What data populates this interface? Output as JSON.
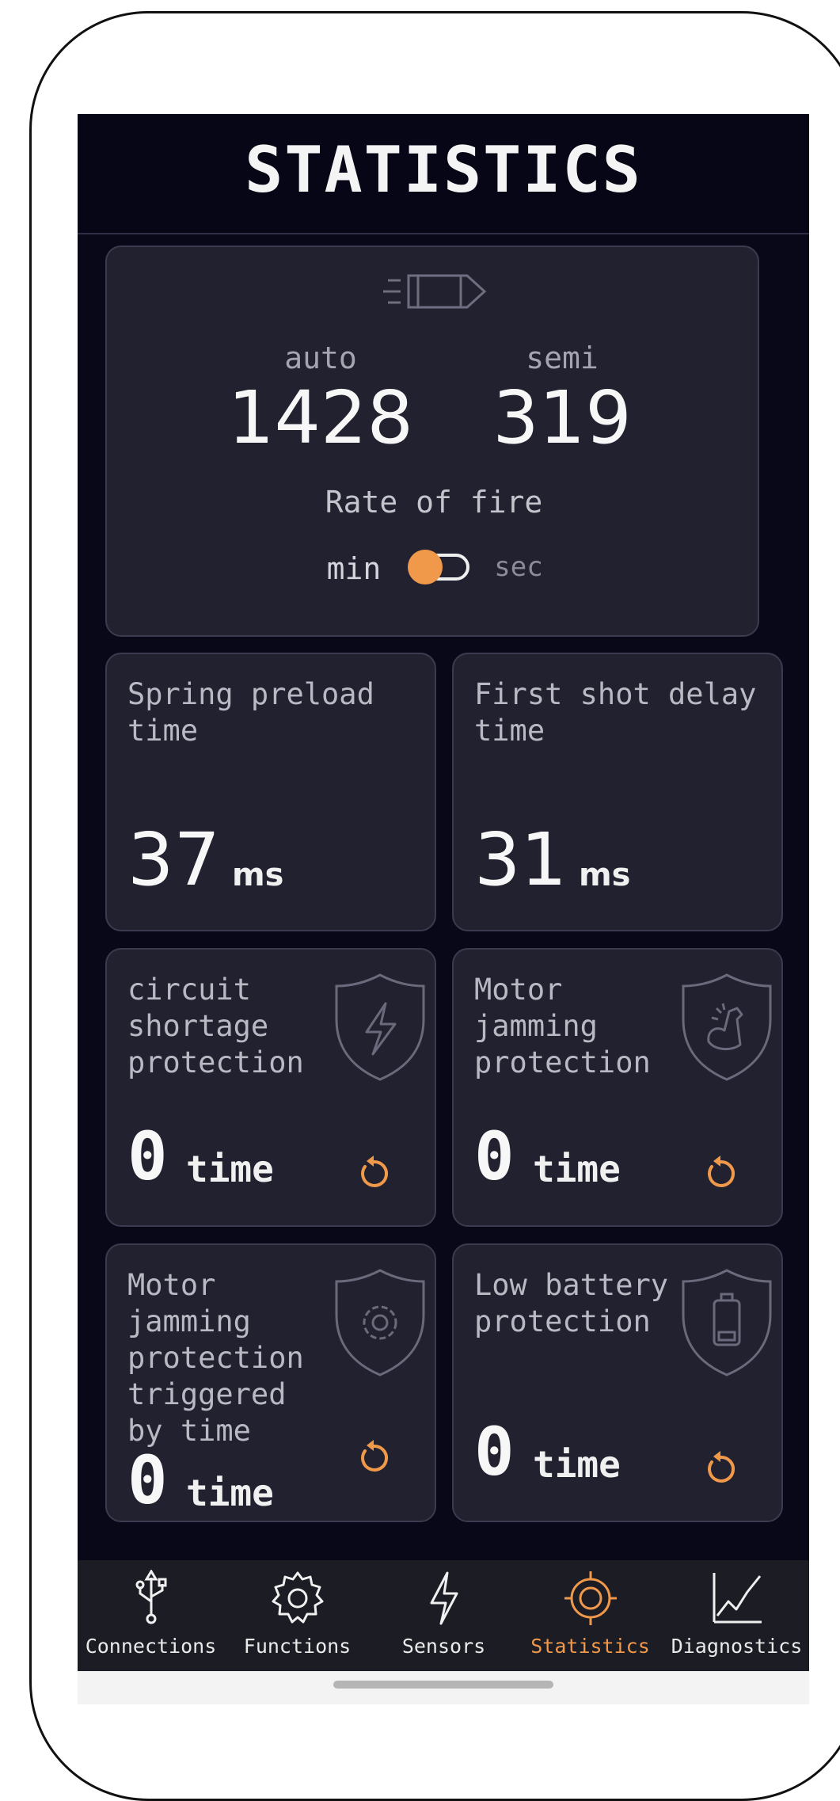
{
  "header": {
    "title": "STATISTICS"
  },
  "rate_card": {
    "icon": "bullet-icon",
    "auto_label": "auto",
    "auto_value": "1428",
    "semi_label": "semi",
    "semi_value": "319",
    "caption": "Rate of fire",
    "toggle": {
      "left_label": "min",
      "right_label": "sec",
      "selected": "min"
    }
  },
  "stats": [
    {
      "title_lines": [
        "Spring preload",
        "time"
      ],
      "value": "37",
      "unit": "ms"
    },
    {
      "title_lines": [
        "First shot delay",
        "time"
      ],
      "value": "31",
      "unit": "ms"
    },
    {
      "title_lines": [
        "circuit",
        "shortage",
        "protection"
      ],
      "value": "0",
      "unit": "time",
      "icon": "shield-lightning-icon"
    },
    {
      "title_lines": [
        "Motor",
        "jamming",
        "protection"
      ],
      "value": "0",
      "unit": "time",
      "icon": "shield-arm-icon"
    },
    {
      "title_lines": [
        "Motor",
        "jamming",
        "protection",
        "triggered",
        "by time"
      ],
      "value": "0",
      "unit": "time",
      "icon": "shield-gear-icon"
    },
    {
      "title_lines": [
        "Low battery",
        "protection"
      ],
      "value": "0",
      "unit": "time",
      "icon": "shield-battery-icon"
    }
  ],
  "nav": {
    "items": [
      {
        "label": "Connections",
        "icon": "usb-icon"
      },
      {
        "label": "Functions",
        "icon": "gear-icon"
      },
      {
        "label": "Sensors",
        "icon": "bolt-icon"
      },
      {
        "label": "Statistics",
        "icon": "target-icon",
        "active": true
      },
      {
        "label": "Diagnostics",
        "icon": "chart-icon"
      }
    ],
    "active": "Statistics"
  },
  "colors": {
    "accent": "#f0994a",
    "background": "#080818",
    "card": "#21212f",
    "text": "#f5f5f5",
    "muted": "#9a9aa8"
  }
}
